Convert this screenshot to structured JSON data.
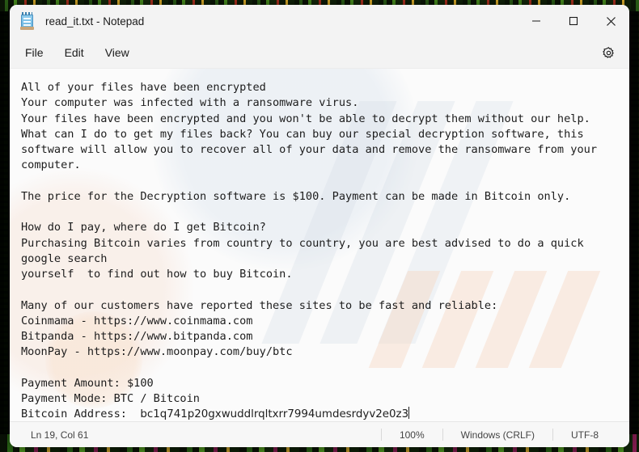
{
  "window": {
    "title": "read_it.txt - Notepad",
    "app_icon": "notepad-icon",
    "minimize_label": "Minimize",
    "maximize_label": "Maximize",
    "close_label": "Close"
  },
  "menu": {
    "items": [
      {
        "label": "File"
      },
      {
        "label": "Edit"
      },
      {
        "label": "View"
      }
    ],
    "settings_icon": "gear-icon",
    "settings_label": "Settings"
  },
  "editor": {
    "body_before_address": "All of your files have been encrypted\nYour computer was infected with a ransomware virus.\nYour files have been encrypted and you won't be able to decrypt them without our help.\nWhat can I do to get my files back? You can buy our special decryption software, this\nsoftware will allow you to recover all of your data and remove the ransomware from your\ncomputer.\n\nThe price for the Decryption software is $100. Payment can be made in Bitcoin only.\n\nHow do I pay, where do I get Bitcoin?\nPurchasing Bitcoin varies from country to country, you are best advised to do a quick\ngoogle search\nyourself  to find out how to buy Bitcoin.\n\nMany of our customers have reported these sites to be fast and reliable:\nCoinmama - https://www.coinmama.com\nBitpanda - https://www.bitpanda.com\nMoonPay - https://www.moonpay.com/buy/btc\n\nPayment Amount: $100\nPayment Mode: BTC / Bitcoin\nBitcoin Address:  ",
    "bitcoin_address": "bc1q741p20gxwuddlrqltxrr7994umdesrdyv2e0z3",
    "lines": [
      "All of your files have been encrypted",
      "Your computer was infected with a ransomware virus.",
      "Your files have been encrypted and you won't be able to decrypt them without our help.",
      "What can I do to get my files back? You can buy our special decryption software, this",
      "software will allow you to recover all of your data and remove the ransomware from your",
      "computer.",
      "",
      "The price for the Decryption software is $100. Payment can be made in Bitcoin only.",
      "",
      "How do I pay, where do I get Bitcoin?",
      "Purchasing Bitcoin varies from country to country, you are best advised to do a quick",
      "google search",
      "yourself  to find out how to buy Bitcoin.",
      "",
      "Many of our customers have reported these sites to be fast and reliable:",
      "Coinmama - https://www.coinmama.com",
      "Bitpanda - https://www.bitpanda.com",
      "MoonPay - https://www.moonpay.com/buy/btc",
      "",
      "Payment Amount: $100",
      "Payment Mode: BTC / Bitcoin",
      "Bitcoin Address:  bc1q741p20gxwuddlrqltxrr7994umdesrdyv2e0z3"
    ],
    "payment": {
      "amount": "$100",
      "mode": "BTC / Bitcoin",
      "price_text": "$100"
    },
    "sites": [
      {
        "name": "Coinmama",
        "url": "https://www.coinmama.com"
      },
      {
        "name": "Bitpanda",
        "url": "https://www.bitpanda.com"
      },
      {
        "name": "MoonPay",
        "url": "https://www.moonpay.com/buy/btc"
      }
    ]
  },
  "status_bar": {
    "cursor_position": "Ln 19, Col 61",
    "zoom": "100%",
    "line_endings": "Windows (CRLF)",
    "encoding": "UTF-8"
  },
  "colors": {
    "window_chrome": "#f3f3f3",
    "editor_background": "#fbfbfb",
    "text": "#1d1d1d",
    "status_text": "#444444",
    "close_hover": "#e81123"
  }
}
